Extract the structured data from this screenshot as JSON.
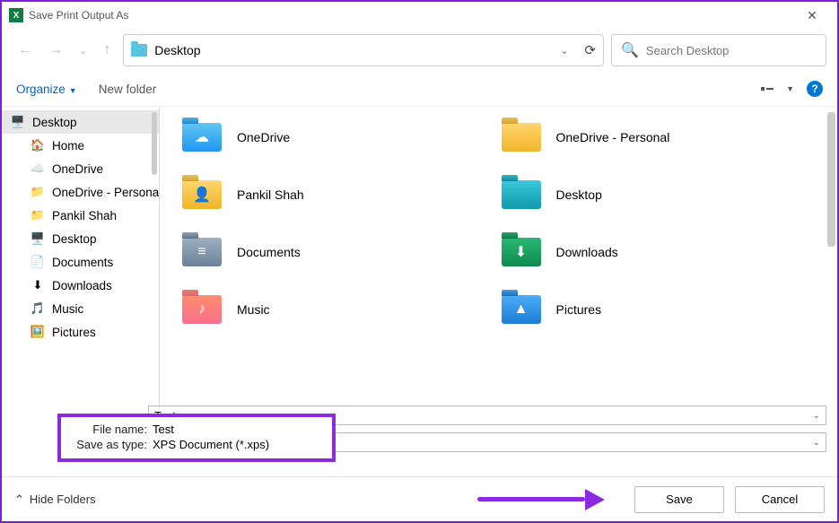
{
  "window_title": "Save Print Output As",
  "path_current": "Desktop",
  "search_placeholder": "Search Desktop",
  "toolbar": {
    "organize": "Organize",
    "new_folder": "New folder"
  },
  "sidebar": [
    {
      "label": "Desktop",
      "icon": "🖥️",
      "selected": true,
      "indent": false
    },
    {
      "label": "Home",
      "icon": "🏠"
    },
    {
      "label": "OneDrive",
      "icon": "☁️"
    },
    {
      "label": "OneDrive - Personal",
      "icon": "📁"
    },
    {
      "label": "Pankil Shah",
      "icon": "📁"
    },
    {
      "label": "Desktop",
      "icon": "🖥️"
    },
    {
      "label": "Documents",
      "icon": "📄"
    },
    {
      "label": "Downloads",
      "icon": "⬇"
    },
    {
      "label": "Music",
      "icon": "🎵"
    },
    {
      "label": "Pictures",
      "icon": "🖼️"
    }
  ],
  "files": [
    {
      "label": "OneDrive",
      "variant": "skyblue",
      "glyph": "☁"
    },
    {
      "label": "OneDrive - Personal",
      "variant": "yellow",
      "glyph": ""
    },
    {
      "label": "Pankil Shah",
      "variant": "yellow",
      "glyph": "👤"
    },
    {
      "label": "Desktop",
      "variant": "teal",
      "glyph": ""
    },
    {
      "label": "Documents",
      "variant": "slate",
      "glyph": "≡"
    },
    {
      "label": "Downloads",
      "variant": "green",
      "glyph": "⬇"
    },
    {
      "label": "Music",
      "variant": "pink",
      "glyph": "♪"
    },
    {
      "label": "Pictures",
      "variant": "blue",
      "glyph": "▲"
    }
  ],
  "file_name_label": "File name:",
  "file_name_value": "Test",
  "save_type_label": "Save as type:",
  "save_type_value": "XPS Document (*.xps)",
  "hide_folders": "Hide Folders",
  "buttons": {
    "save": "Save",
    "cancel": "Cancel"
  }
}
